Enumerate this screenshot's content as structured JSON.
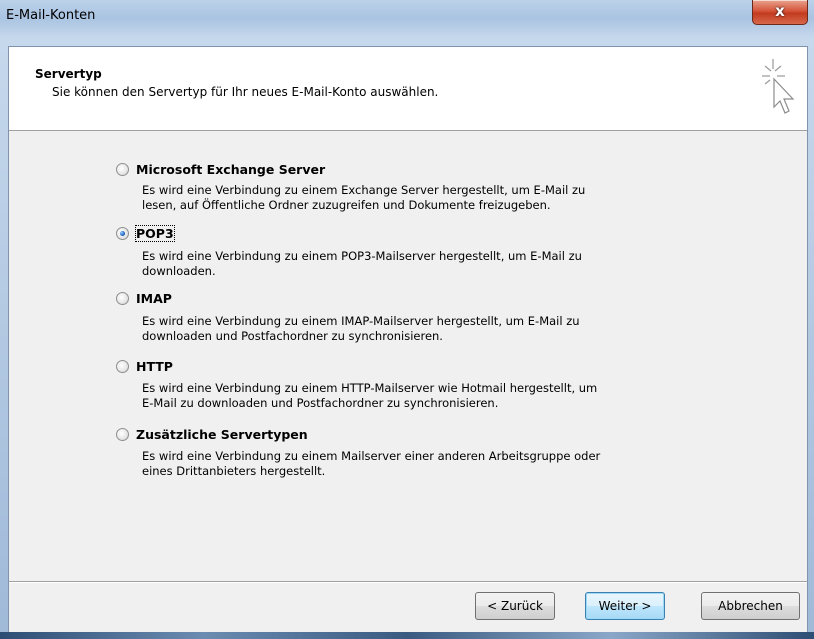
{
  "window": {
    "title": "E-Mail-Konten",
    "close_label": "x"
  },
  "header": {
    "title": "Servertyp",
    "subtitle": "Sie können den Servertyp für Ihr neues E-Mail-Konto auswählen."
  },
  "options": [
    {
      "label": "Microsoft Exchange Server",
      "checked": false,
      "description_lines": [
        "Es wird eine Verbindung zu einem Exchange Server hergestellt, um E-Mail zu",
        "lesen, auf Öffentliche Ordner zuzugreifen und Dokumente freizugeben."
      ]
    },
    {
      "label": "POP3",
      "checked": true,
      "description_lines": [
        "Es wird eine Verbindung zu einem POP3-Mailserver hergestellt, um E-Mail zu",
        "downloaden."
      ]
    },
    {
      "label": "IMAP",
      "checked": false,
      "description_lines": [
        "Es wird eine Verbindung zu einem IMAP-Mailserver hergestellt, um E-Mail zu",
        "downloaden und Postfachordner zu synchronisieren."
      ]
    },
    {
      "label": "HTTP",
      "checked": false,
      "description_lines": [
        "Es wird eine Verbindung zu einem HTTP-Mailserver wie Hotmail hergestellt, um",
        "E-Mail zu downloaden und Postfachordner zu synchronisieren."
      ]
    },
    {
      "label": "Zusätzliche Servertypen",
      "checked": false,
      "description_lines": [
        "Es wird eine Verbindung zu einem Mailserver einer anderen Arbeitsgruppe oder",
        "eines Drittanbieters hergestellt."
      ]
    }
  ],
  "buttons": {
    "back": "< Zurück",
    "next": "Weiter >",
    "cancel": "Abbrechen"
  },
  "icons": {
    "wizard": "cursor-sparkle-icon",
    "radio": "radio-button-icon",
    "close": "close-icon"
  },
  "colors": {
    "close_button": "#c23b1f",
    "radio_selected": "#1b5fbf",
    "default_button_border": "#3c7fb1"
  }
}
